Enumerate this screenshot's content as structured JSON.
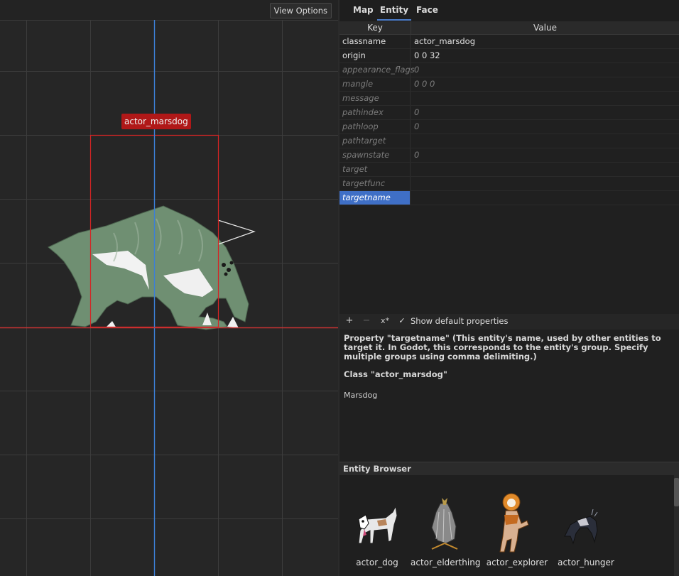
{
  "viewport": {
    "view_options_label": "View Options",
    "entity_tag": "actor_marsdog"
  },
  "tabs": [
    {
      "label": "Map"
    },
    {
      "label": "Entity"
    },
    {
      "label": "Face"
    }
  ],
  "table": {
    "key_header": "Key",
    "value_header": "Value",
    "rows": [
      {
        "key": "classname",
        "value": "actor_marsdog"
      },
      {
        "key": "origin",
        "value": "0 0 32"
      },
      {
        "key": "appearance_flags",
        "value": "0"
      },
      {
        "key": "mangle",
        "value": "0 0 0"
      },
      {
        "key": "message",
        "value": ""
      },
      {
        "key": "pathindex",
        "value": "0"
      },
      {
        "key": "pathloop",
        "value": "0"
      },
      {
        "key": "pathtarget",
        "value": ""
      },
      {
        "key": "spawnstate",
        "value": "0"
      },
      {
        "key": "target",
        "value": ""
      },
      {
        "key": "targetfunc",
        "value": ""
      },
      {
        "key": "targetname",
        "value": ""
      }
    ]
  },
  "toolbar": {
    "add": "+",
    "remove": "−",
    "clear": "x*",
    "checkbox_mark": "✓",
    "show_defaults_label": "Show default properties"
  },
  "help": {
    "property_text": "Property \"targetname\" (This entity's name, used by other entities to target it. In Godot, this corresponds to the entity's group. Specify multiple groups using comma delimiting.)",
    "class_text": "Class \"actor_marsdog\"",
    "class_description": "Marsdog"
  },
  "browser": {
    "title": "Entity Browser",
    "items": [
      {
        "label": "actor_dog"
      },
      {
        "label": "actor_elderthing"
      },
      {
        "label": "actor_explorer"
      },
      {
        "label": "actor_hunger"
      }
    ]
  },
  "colors": {
    "accent": "#4b7cc9",
    "selection": "#3f6fc6",
    "entity_tag": "#b01818",
    "bbox": "#d42424",
    "axis_blue": "#3d7fd6",
    "axis_red": "#c83232"
  }
}
